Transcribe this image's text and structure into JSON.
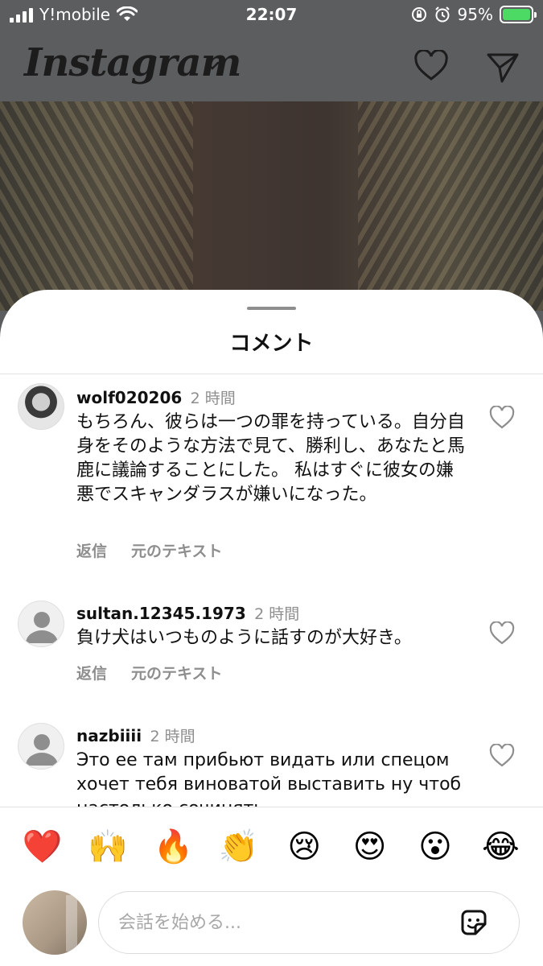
{
  "status_bar": {
    "carrier": "Y!mobile",
    "time": "22:07",
    "battery": "95%"
  },
  "header": {
    "logo": "Instagram"
  },
  "sheet": {
    "title": "コメント"
  },
  "comments": [
    {
      "username": "wolf020206",
      "time": "2 時間",
      "text": "もちろん、彼らは一つの罪を持っている。自分自身をそのような方法で見て、勝利し、あなたと馬鹿に議論することにした。 私はすぐに彼女の嫌悪でスキャンダラスが嫌いになった。",
      "reply": "返信",
      "original": "元のテキスト"
    },
    {
      "username": "sultan.12345.1973",
      "time": "2 時間",
      "text": "負け犬はいつものように話すのが大好き。",
      "reply": "返信",
      "original": "元のテキスト"
    },
    {
      "username": "nazbiiii",
      "time": "2 時間",
      "text": "Это ее там прибьют видать или спецом хочет тебя виноватой выставить ну чтоб настолько сочинять"
    }
  ],
  "emojis": [
    "❤️",
    "🙌",
    "🔥",
    "👏",
    "😢",
    "😍",
    "😮",
    "😂"
  ],
  "input": {
    "placeholder": "会話を始める..."
  },
  "colors": {
    "sheet_bg": "#ffffff",
    "muted": "#8e8e8e",
    "battery": "#4cd964"
  }
}
